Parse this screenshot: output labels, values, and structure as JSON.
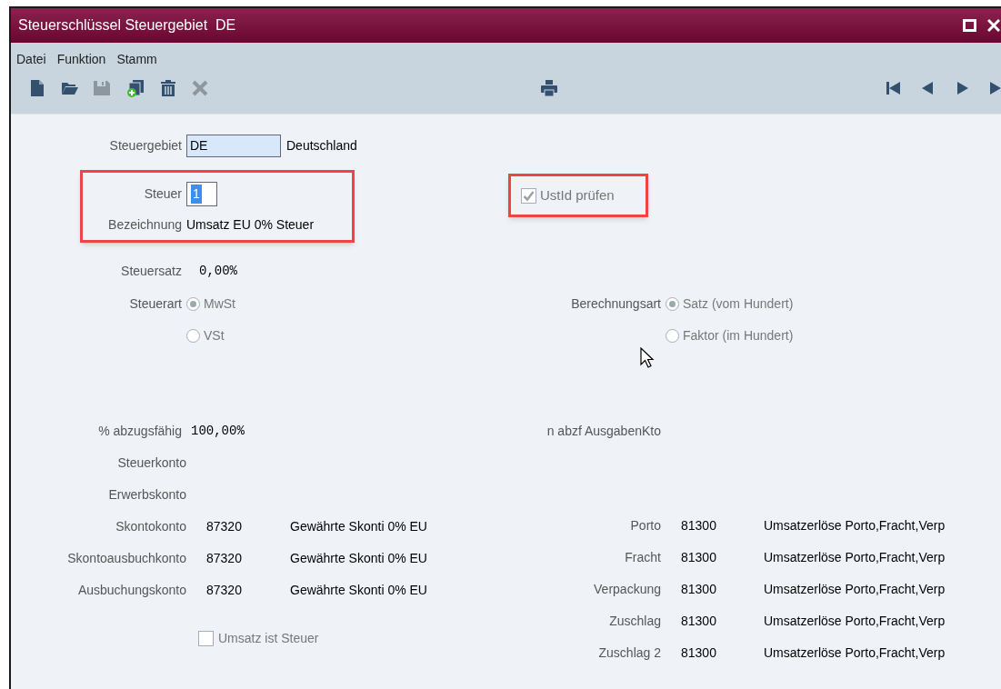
{
  "window": {
    "title": "Steuerschlüssel Steuergebiet  DE"
  },
  "menu": [
    "Datei",
    "Funktion",
    "Stamm"
  ],
  "toolbar": [
    {
      "kind": "new",
      "disabled": false
    },
    {
      "kind": "open",
      "disabled": false
    },
    {
      "kind": "save",
      "disabled": true
    },
    {
      "kind": "copy",
      "disabled": false
    },
    {
      "kind": "delete",
      "disabled": false
    },
    {
      "kind": "cancel",
      "disabled": true
    },
    {
      "kind": "print",
      "disabled": false
    },
    {
      "kind": "first",
      "disabled": false
    },
    {
      "kind": "prev",
      "disabled": false
    },
    {
      "kind": "next",
      "disabled": false
    },
    {
      "kind": "last",
      "disabled": false
    }
  ],
  "steuergebiet": {
    "label": "Steuergebiet",
    "value": "DE",
    "name": "Deutschland"
  },
  "steuer": {
    "label": "Steuer",
    "value": "1",
    "selected": true
  },
  "bezeichnung": {
    "label": "Bezeichnung",
    "value": "Umsatz EU 0% Steuer"
  },
  "ustid": {
    "label": "UstId prüfen",
    "checked": true
  },
  "steuersatz": {
    "label": "Steuersatz",
    "value": "0,00%"
  },
  "steuerart": {
    "label": "Steuerart",
    "options": [
      {
        "label": "MwSt",
        "selected": true
      },
      {
        "label": "VSt",
        "selected": false
      }
    ]
  },
  "berechnungsart": {
    "label": "Berechnungsart",
    "options": [
      {
        "label": "Satz (vom Hundert)",
        "selected": true
      },
      {
        "label": "Faktor (im Hundert)",
        "selected": false
      }
    ]
  },
  "abzugsfaehig": {
    "label": "% abzugsfähig",
    "value": "100,00%"
  },
  "ausgaben_kto": {
    "label": "n abzf AusgabenKto"
  },
  "accounts_left": [
    {
      "label": "Steuerkonto"
    },
    {
      "label": "Erwerbskonto"
    },
    {
      "label": "Skontokonto",
      "number": "87320",
      "description": "Gewährte Skonti 0% EU"
    },
    {
      "label": "Skontoausbuchkonto",
      "number": "87320",
      "description": "Gewährte Skonti 0% EU"
    },
    {
      "label": "Ausbuchungskonto",
      "number": "87320",
      "description": "Gewährte Skonti 0% EU"
    }
  ],
  "accounts_right": [
    {
      "label": "Porto",
      "number": "81300",
      "description": "Umsatzerlöse Porto,Fracht,Verp"
    },
    {
      "label": "Fracht",
      "number": "81300",
      "description": "Umsatzerlöse Porto,Fracht,Verp"
    },
    {
      "label": "Verpackung",
      "number": "81300",
      "description": "Umsatzerlöse Porto,Fracht,Verp"
    },
    {
      "label": "Zuschlag",
      "number": "81300",
      "description": "Umsatzerlöse Porto,Fracht,Verp"
    },
    {
      "label": "Zuschlag 2",
      "number": "81300",
      "description": "Umsatzerlöse Porto,Fracht,Verp"
    }
  ],
  "umsatz_ist_steuer": {
    "label": "Umsatz ist Steuer",
    "checked": false
  }
}
